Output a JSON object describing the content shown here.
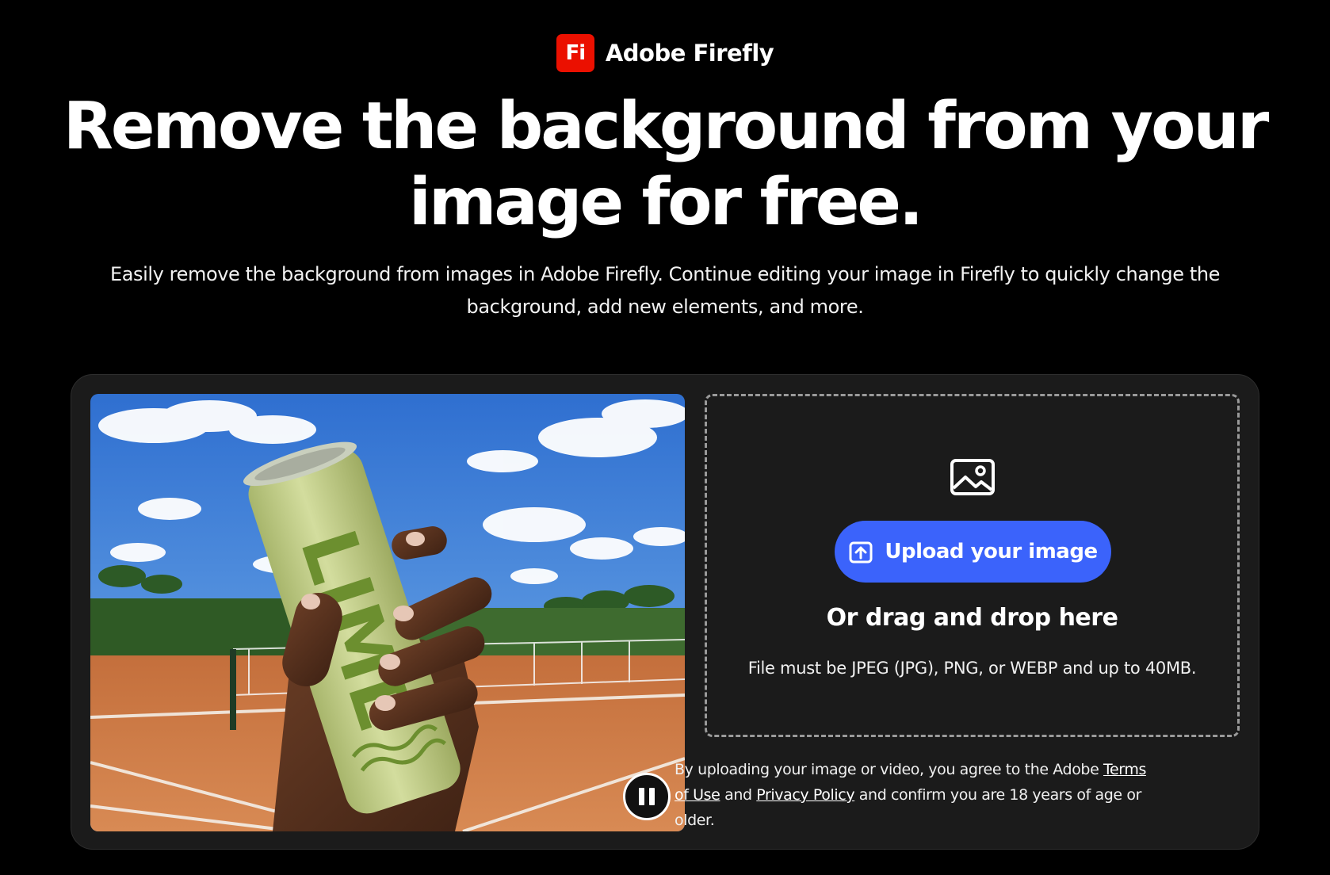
{
  "brand": {
    "logo_text": "Fi",
    "name": "Adobe Firefly"
  },
  "hero": {
    "headline_line1": "Remove the background from your",
    "headline_line2": "image for free.",
    "subhead": "Easily remove the background from images in Adobe Firefly. Continue editing your image in Firefly to quickly change the background, add new elements, and more."
  },
  "preview": {
    "can_text": "LIME",
    "pause_icon": "pause-icon"
  },
  "upload": {
    "icon": "image-icon",
    "button_label": "Upload your image",
    "drag_text": "Or drag and drop here",
    "file_hint": "File must be JPEG (JPG), PNG, or WEBP and up to 40MB."
  },
  "legal": {
    "text_before": "By uploading your image or video, you agree to the Adobe ",
    "terms_link": "Terms of Use",
    "text_middle": " and ",
    "privacy_link": "Privacy Policy",
    "text_after": " and confirm you are 18 years of age or older."
  },
  "colors": {
    "background": "#000000",
    "card": "#1b1b1b",
    "accent": "#3B63FB",
    "brand_red": "#EB1000"
  }
}
